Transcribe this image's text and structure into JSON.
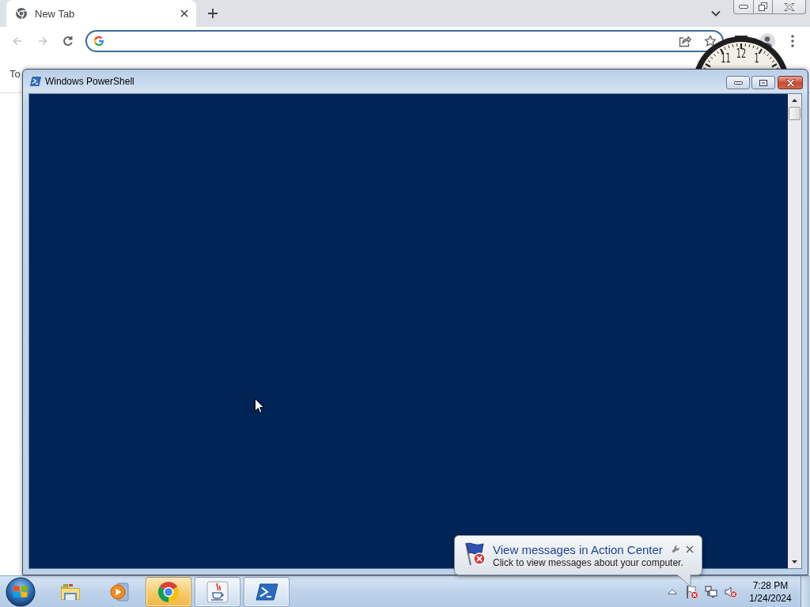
{
  "browser": {
    "tabs": [
      {
        "title": "New Tab",
        "selected": true
      }
    ],
    "nav_buttons": [
      {
        "kind": "back",
        "disabled": true
      },
      {
        "kind": "forward",
        "disabled": true
      },
      {
        "kind": "reload",
        "disabled": false
      }
    ],
    "bookmarks_bar": {
      "text": "To"
    }
  },
  "clock_gadget": {
    "numerals": [
      "11",
      "12",
      "1"
    ]
  },
  "powershell_window": {
    "title": "Windows PowerShell"
  },
  "notification": {
    "title": "View messages in Action Center",
    "message": "Click to view messages about your computer."
  },
  "taskbar": {
    "items": [
      {
        "kind": "explorer",
        "running": false,
        "flashing": false
      },
      {
        "kind": "media",
        "running": false,
        "flashing": false
      },
      {
        "kind": "chrome",
        "running": true,
        "flashing": true
      },
      {
        "kind": "java",
        "running": true,
        "flashing": false
      },
      {
        "kind": "powershell",
        "running": true,
        "flashing": false
      }
    ],
    "tray": {
      "action_center": {
        "alert": true
      },
      "volume": {
        "muted": true
      }
    },
    "clock": {
      "time": "7:28 PM",
      "date": "1/24/2024"
    }
  }
}
